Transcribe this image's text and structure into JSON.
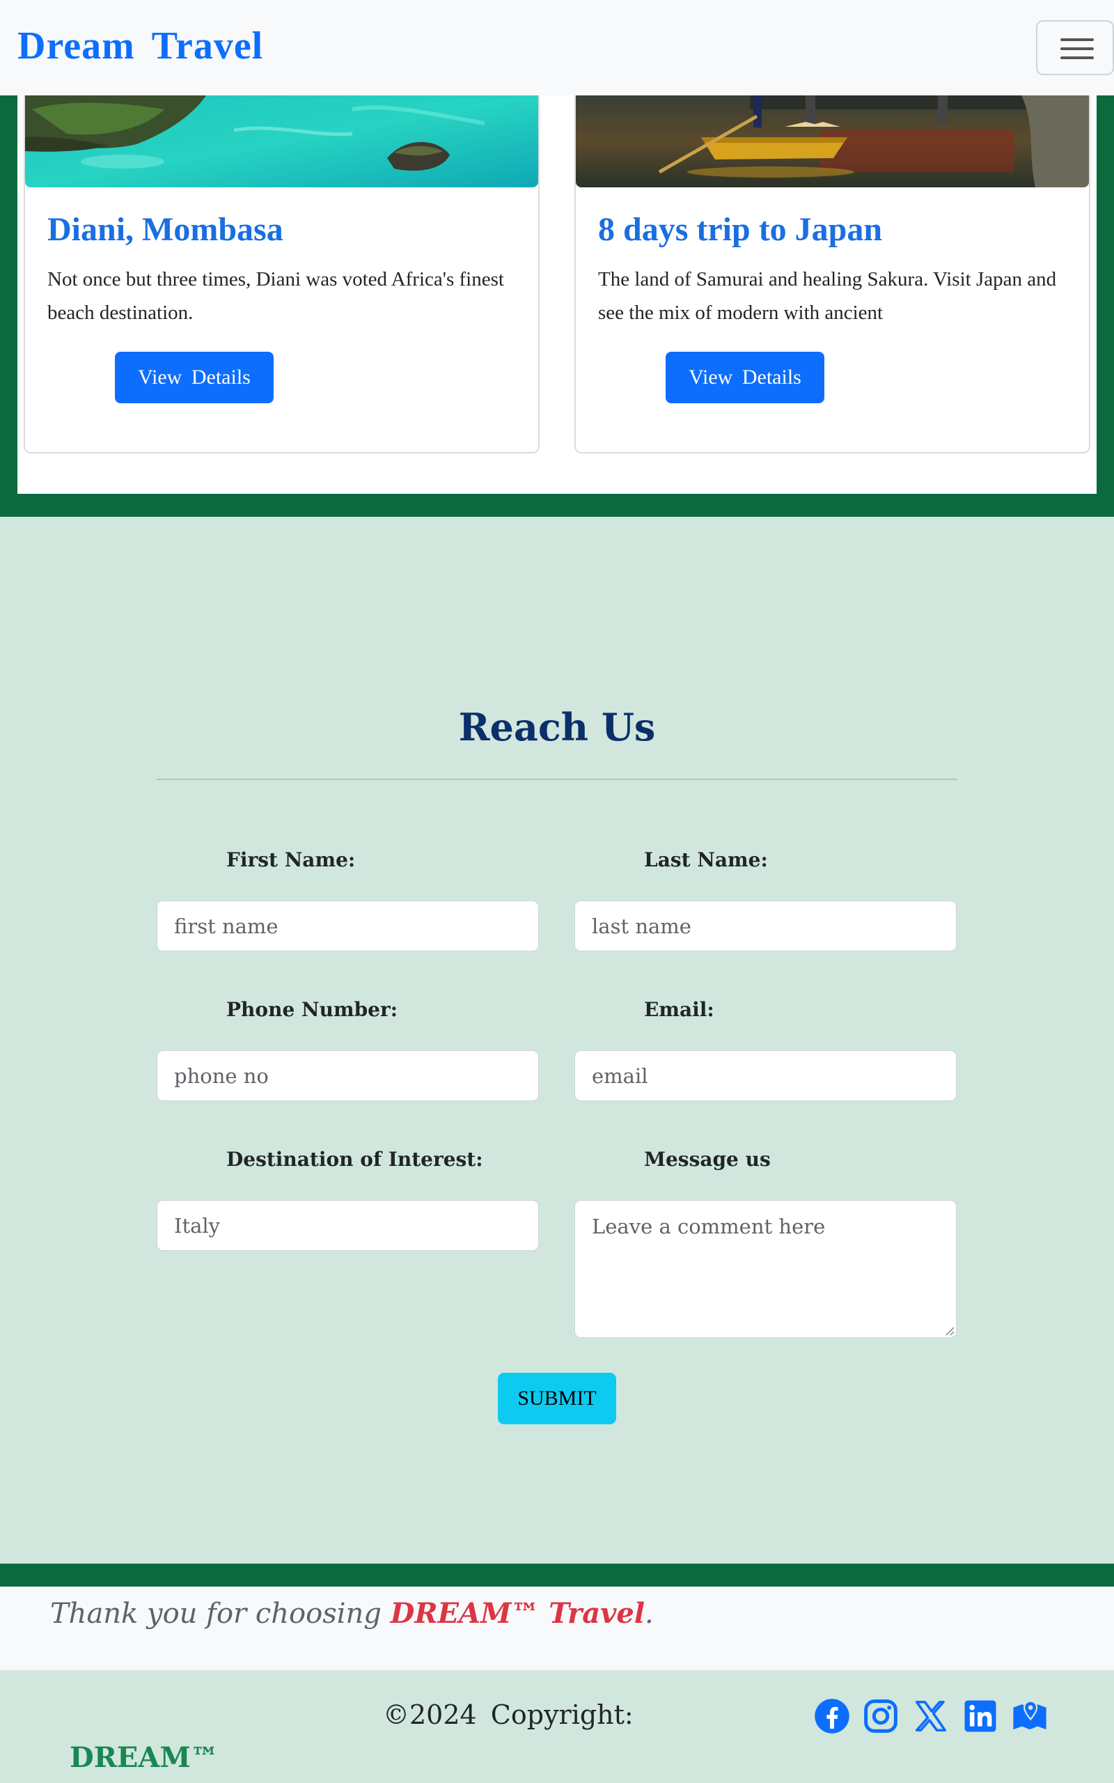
{
  "navbar": {
    "brand": "Dream  Travel"
  },
  "cards": [
    {
      "title": "Diani, Mombasa",
      "text": "Not once but three times, Diani was voted Africa's finest beach destination.",
      "button_label": "View  Details"
    },
    {
      "title": "8 days trip to Japan",
      "text": "The land of Samurai and healing Sakura. Visit Japan and see the mix of modern with ancient",
      "button_label": "View  Details"
    }
  ],
  "contact": {
    "title": "Reach Us",
    "first_name": {
      "label": "First Name:",
      "placeholder": "first name"
    },
    "last_name": {
      "label": "Last Name:",
      "placeholder": "last name"
    },
    "phone": {
      "label": "Phone Number:",
      "placeholder": "phone no"
    },
    "email": {
      "label": "Email:",
      "placeholder": "email"
    },
    "destination": {
      "label": "Destination of Interest:",
      "placeholder": "Italy"
    },
    "message": {
      "label": "Message us",
      "placeholder": "Leave a comment here"
    },
    "submit_label": "SUBMIT"
  },
  "footer": {
    "thanks_prefix": "Thank you for choosing ",
    "thanks_brand": "DREAM™ Travel",
    "thanks_suffix": ".",
    "copyright": "©2024  Copyright:",
    "brand": "DREAM™",
    "social_icons": [
      "facebook-icon",
      "instagram-icon",
      "x-icon",
      "linkedin-icon",
      "map-icon"
    ],
    "social_color": "#0d6efd"
  },
  "colors": {
    "primary": "#0d6efd",
    "dark_green": "#0b6b3f",
    "mint_bg": "#d1e7dd",
    "info": "#0dcaf0",
    "danger": "#dc3545",
    "heading_navy": "#0b2f6b"
  }
}
